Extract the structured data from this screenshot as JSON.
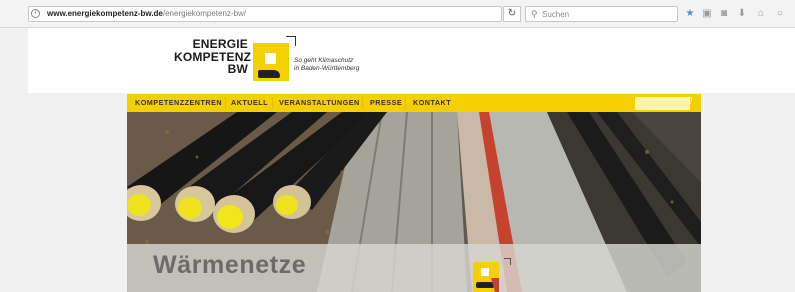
{
  "browser": {
    "url_host": "www.energiekompetenz-bw.de",
    "url_path": "/energiekompetenz-bw/",
    "search_placeholder": "Suchen",
    "icons": [
      "info-icon",
      "reload-icon",
      "search-icon",
      "bookmark-star-icon",
      "clipboard-icon",
      "pocket-icon",
      "download-icon",
      "home-icon",
      "sync-icon"
    ]
  },
  "logo": {
    "line1": "ENERGIE",
    "line2": "KOMPETENZ",
    "line3": "BW",
    "tagline": "So geht Klimaschutz\nin Baden-Württemberg"
  },
  "nav": {
    "items": [
      "KOMPETENZZENTREN",
      "AKTUELL",
      "VERANSTALTUNGEN",
      "PRESSE",
      "KONTAKT"
    ]
  },
  "hero": {
    "title": "Wärmenetze"
  },
  "colors": {
    "brand_yellow": "#f5d000",
    "pipe_end_yellow": "#f2e51a",
    "chrome_bg": "#f3f3f3"
  }
}
